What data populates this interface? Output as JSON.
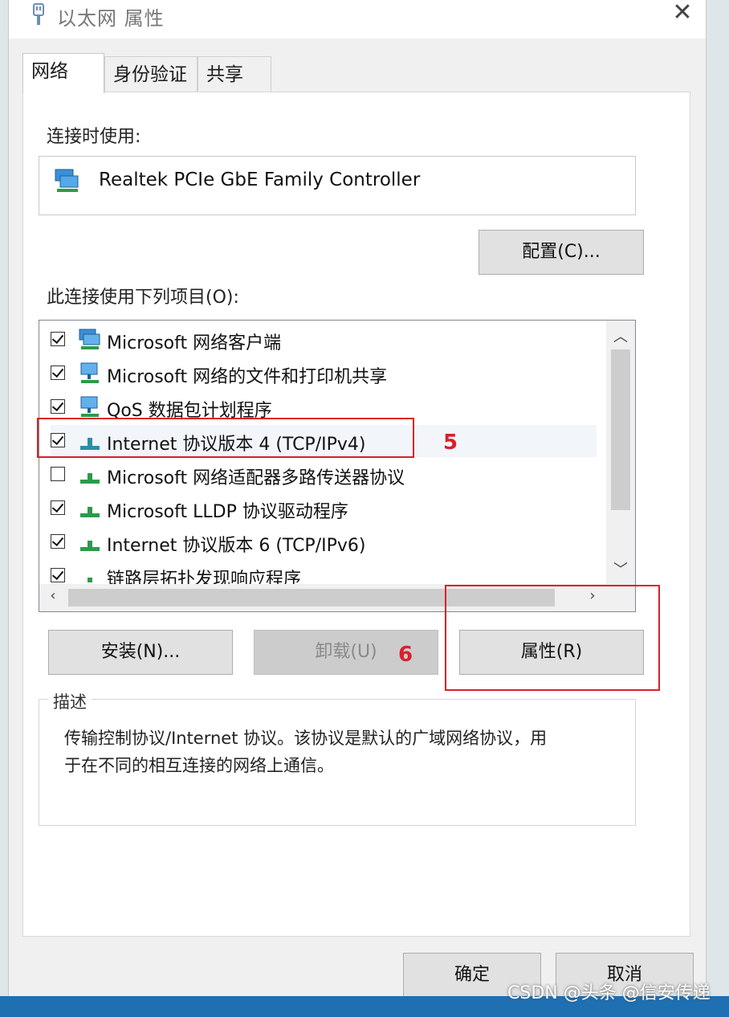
{
  "window": {
    "title": "以太网 属性"
  },
  "tabs": [
    {
      "label": "网络",
      "active": true
    },
    {
      "label": "身份验证",
      "active": false
    },
    {
      "label": "共享",
      "active": false
    }
  ],
  "connection": {
    "using_label": "连接时使用:",
    "adapter_name": "Realtek PCIe GbE Family Controller",
    "configure_button": "配置(C)..."
  },
  "items_section": {
    "label": "此连接使用下列项目(O):",
    "items": [
      {
        "label": "Microsoft 网络客户端",
        "checked": true
      },
      {
        "label": "Microsoft 网络的文件和打印机共享",
        "checked": true
      },
      {
        "label": "QoS 数据包计划程序",
        "checked": true
      },
      {
        "label": "Internet 协议版本 4 (TCP/IPv4)",
        "checked": true
      },
      {
        "label": "Microsoft 网络适配器多路传送器协议",
        "checked": false
      },
      {
        "label": "Microsoft LLDP 协议驱动程序",
        "checked": true
      },
      {
        "label": "Internet 协议版本 6 (TCP/IPv6)",
        "checked": true
      },
      {
        "label": "链路层拓扑发现响应程序",
        "checked": true
      }
    ]
  },
  "actions": {
    "install": "安装(N)...",
    "uninstall": "卸载(U)",
    "properties": "属性(R)"
  },
  "description": {
    "title": "描述",
    "text_line1": "传输控制协议/Internet 协议。该协议是默认的广域网络协议，用",
    "text_line2": "于在不同的相互连接的网络上通信。"
  },
  "annotations": {
    "step5": "5",
    "step6": "6",
    "color": "#d9202a"
  },
  "footer": {
    "ok": "确定",
    "cancel": "取消"
  },
  "watermark": "CSDN @头条 @信安传递"
}
